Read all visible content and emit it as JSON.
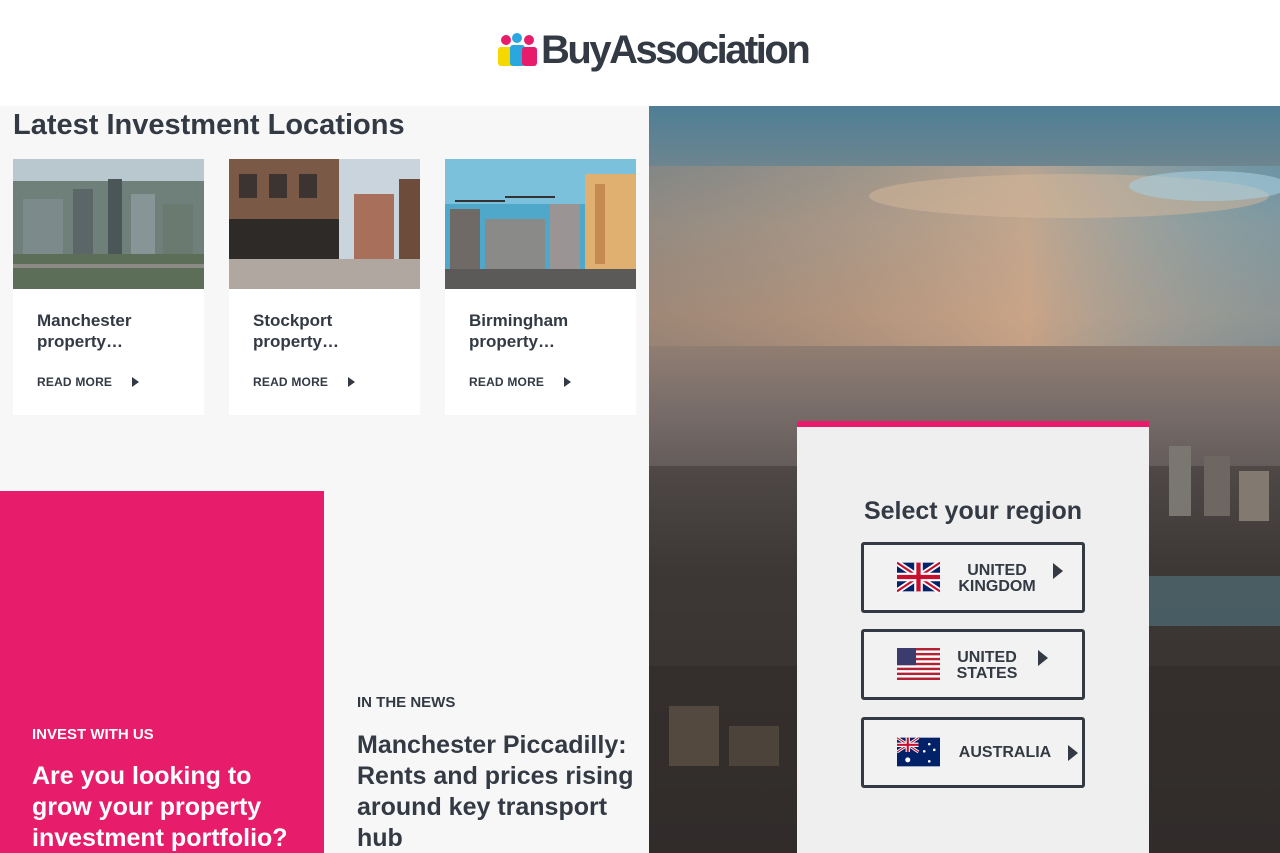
{
  "brand": {
    "name": "BuyAssociation"
  },
  "locations": {
    "title": "Latest Investment Locations",
    "cards": [
      {
        "title": "Manchester property…",
        "cta": "READ MORE"
      },
      {
        "title": "Stockport property…",
        "cta": "READ MORE"
      },
      {
        "title": "Birmingham property…",
        "cta": "READ MORE"
      }
    ]
  },
  "invest": {
    "kicker": "INVEST WITH US",
    "headline": "Are you looking to grow your property investment portfolio?"
  },
  "news": {
    "kicker": "IN THE NEWS",
    "headline": "Manchester Piccadilly: Rents and prices rising around key transport hub"
  },
  "region": {
    "title": "Select your region",
    "options": [
      {
        "label": "UNITED KINGDOM",
        "flag": "uk-flag-icon"
      },
      {
        "label": "UNITED STATES",
        "flag": "us-flag-icon"
      },
      {
        "label": "AUSTRALIA",
        "flag": "australia-flag-icon"
      }
    ]
  },
  "colors": {
    "accent": "#e71c6b",
    "text": "#333a44",
    "panel": "#efefef"
  }
}
